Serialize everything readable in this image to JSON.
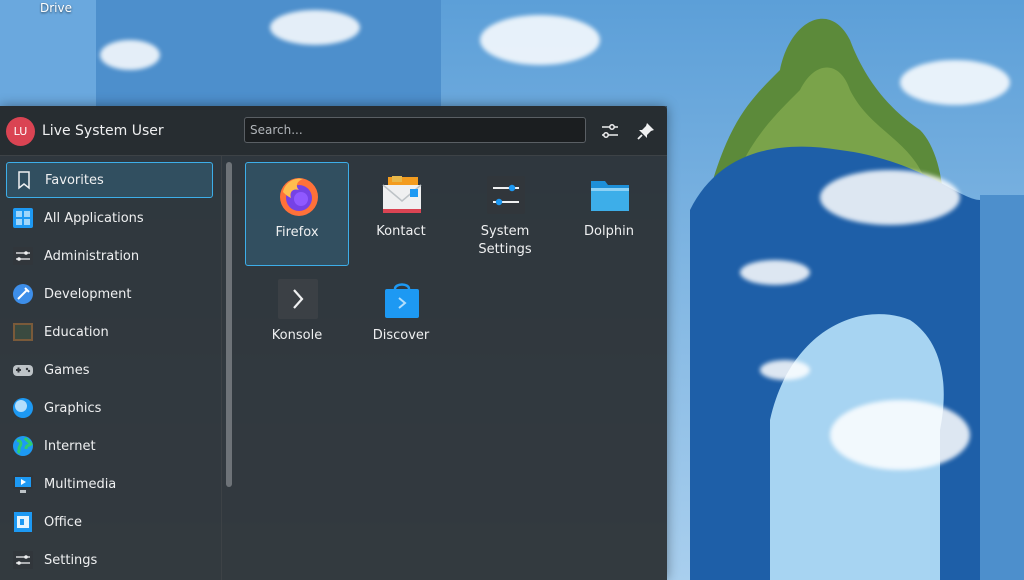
{
  "desktop": {
    "icon_label": "Drive"
  },
  "launcher": {
    "user": {
      "initials": "LU",
      "name": "Live System User"
    },
    "search": {
      "placeholder": "Search..."
    },
    "header_buttons": [
      {
        "icon": "configure-icon"
      },
      {
        "icon": "pin-icon"
      }
    ],
    "categories": [
      {
        "label": "Favorites",
        "icon": "bookmark-icon",
        "active": true
      },
      {
        "label": "All Applications",
        "icon": "all-applications-icon"
      },
      {
        "label": "Administration",
        "icon": "administration-icon"
      },
      {
        "label": "Development",
        "icon": "development-icon"
      },
      {
        "label": "Education",
        "icon": "education-icon"
      },
      {
        "label": "Games",
        "icon": "gamepad-icon"
      },
      {
        "label": "Graphics",
        "icon": "graphics-icon"
      },
      {
        "label": "Internet",
        "icon": "globe-icon"
      },
      {
        "label": "Multimedia",
        "icon": "multimedia-icon"
      },
      {
        "label": "Office",
        "icon": "office-icon"
      },
      {
        "label": "Settings",
        "icon": "settings-icon"
      }
    ],
    "apps": [
      {
        "label": "Firefox",
        "icon": "firefox-icon",
        "selected": true
      },
      {
        "label": "Kontact",
        "icon": "kontact-icon"
      },
      {
        "label": "System\nSettings",
        "icon": "system-settings-icon"
      },
      {
        "label": "Dolphin",
        "icon": "dolphin-folder-icon"
      },
      {
        "label": "Konsole",
        "icon": "konsole-icon"
      },
      {
        "label": "Discover",
        "icon": "discover-icon"
      }
    ]
  }
}
